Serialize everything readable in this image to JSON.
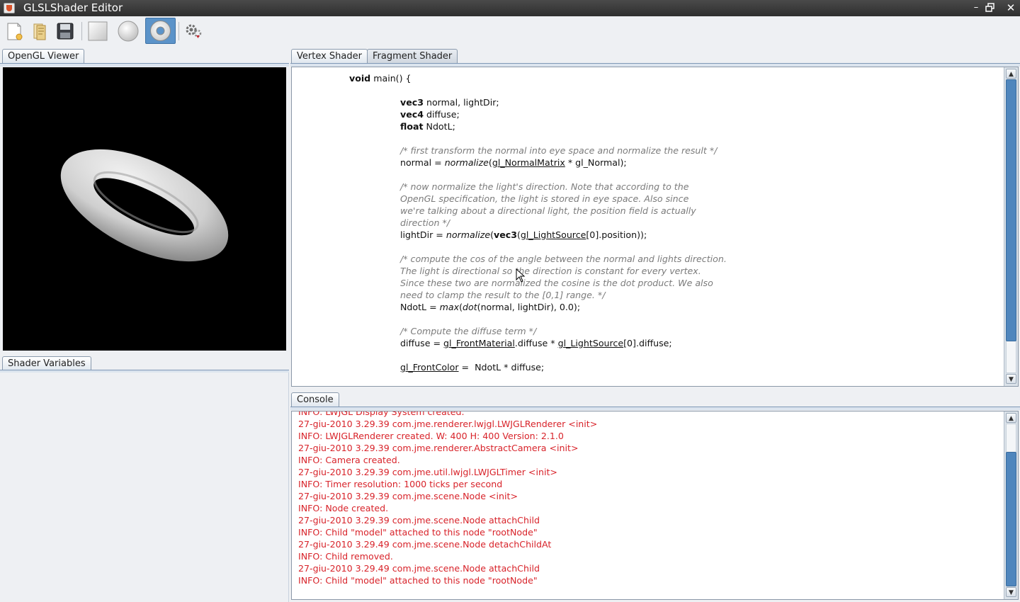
{
  "window": {
    "title": "GLSLShader Editor"
  },
  "toolbar": {
    "buttons": [
      {
        "name": "new-shader",
        "icon": "new-file-icon"
      },
      {
        "name": "open-shader",
        "icon": "open-folder-icon"
      },
      {
        "name": "save-shader",
        "icon": "floppy-disk-icon"
      },
      {
        "name": "quad-model",
        "icon": "square-icon"
      },
      {
        "name": "sphere-model",
        "icon": "sphere-icon"
      },
      {
        "name": "torus-model",
        "icon": "torus-icon",
        "selected": true
      },
      {
        "name": "compile-shader",
        "icon": "gears-icon"
      }
    ]
  },
  "left": {
    "viewer_tab": "OpenGL Viewer",
    "variables_tab": "Shader Variables"
  },
  "editor": {
    "tabs": [
      "Vertex Shader",
      "Fragment Shader"
    ],
    "active_tab": "Vertex Shader",
    "code_lines": [
      {
        "indent": 0,
        "parts": [
          {
            "t": "void",
            "s": "kw"
          },
          {
            "t": " main() {"
          }
        ]
      },
      {
        "indent": 0,
        "parts": []
      },
      {
        "indent": 1,
        "parts": [
          {
            "t": "vec3",
            "s": "kw"
          },
          {
            "t": " normal, lightDir;"
          }
        ]
      },
      {
        "indent": 1,
        "parts": [
          {
            "t": "vec4",
            "s": "kw"
          },
          {
            "t": " diffuse;"
          }
        ]
      },
      {
        "indent": 1,
        "parts": [
          {
            "t": "float",
            "s": "kw"
          },
          {
            "t": " NdotL;"
          }
        ]
      },
      {
        "indent": 1,
        "parts": []
      },
      {
        "indent": 1,
        "parts": [
          {
            "t": "/* first transform the normal into eye space and normalize the result */",
            "s": "cm"
          }
        ]
      },
      {
        "indent": 1,
        "parts": [
          {
            "t": "normal = "
          },
          {
            "t": "normalize",
            "s": "fn"
          },
          {
            "t": "("
          },
          {
            "t": "gl_NormalMatrix",
            "s": "ul"
          },
          {
            "t": " * gl_Normal);"
          }
        ]
      },
      {
        "indent": 1,
        "parts": []
      },
      {
        "indent": 1,
        "parts": [
          {
            "t": "/* now normalize the light's direction. Note that according to the",
            "s": "cm"
          }
        ]
      },
      {
        "indent": 1,
        "parts": [
          {
            "t": "OpenGL specification, the light is stored in eye space. Also since",
            "s": "cm"
          }
        ]
      },
      {
        "indent": 1,
        "parts": [
          {
            "t": "we're talking about a directional light, the position field is actually",
            "s": "cm"
          }
        ]
      },
      {
        "indent": 1,
        "parts": [
          {
            "t": "direction */",
            "s": "cm"
          }
        ]
      },
      {
        "indent": 1,
        "parts": [
          {
            "t": "lightDir = "
          },
          {
            "t": "normalize",
            "s": "fn"
          },
          {
            "t": "("
          },
          {
            "t": "vec3",
            "s": "kw"
          },
          {
            "t": "("
          },
          {
            "t": "gl_LightSource",
            "s": "ul"
          },
          {
            "t": "[0].position));"
          }
        ]
      },
      {
        "indent": 1,
        "parts": []
      },
      {
        "indent": 1,
        "parts": [
          {
            "t": "/* compute the cos of the angle between the normal and lights direction.",
            "s": "cm"
          }
        ]
      },
      {
        "indent": 1,
        "parts": [
          {
            "t": "The light is directional so the direction is constant for every vertex.",
            "s": "cm"
          }
        ]
      },
      {
        "indent": 1,
        "parts": [
          {
            "t": "Since these two are normalized the cosine is the dot product. We also",
            "s": "cm"
          }
        ]
      },
      {
        "indent": 1,
        "parts": [
          {
            "t": "need to clamp the result to the [0,1] range. */",
            "s": "cm"
          }
        ]
      },
      {
        "indent": 1,
        "parts": [
          {
            "t": "NdotL = "
          },
          {
            "t": "max",
            "s": "fn"
          },
          {
            "t": "("
          },
          {
            "t": "dot",
            "s": "fn"
          },
          {
            "t": "(normal, lightDir), 0.0);"
          }
        ]
      },
      {
        "indent": 1,
        "parts": []
      },
      {
        "indent": 1,
        "parts": [
          {
            "t": "/* Compute the diffuse term */",
            "s": "cm"
          }
        ]
      },
      {
        "indent": 1,
        "parts": [
          {
            "t": "diffuse = "
          },
          {
            "t": "gl_FrontMaterial",
            "s": "ul"
          },
          {
            "t": ".diffuse * "
          },
          {
            "t": "gl_LightSource",
            "s": "ul"
          },
          {
            "t": "[0].diffuse;"
          }
        ]
      },
      {
        "indent": 1,
        "parts": []
      },
      {
        "indent": 1,
        "parts": [
          {
            "t": "gl_FrontColor",
            "s": "ul"
          },
          {
            "t": " =  NdotL * diffuse;"
          }
        ]
      }
    ],
    "scroll_fraction": 0.85
  },
  "console": {
    "tab": "Console",
    "lines": [
      "INFO: LWJGL Display System created.",
      "27-giu-2010 3.29.39 com.jme.renderer.lwjgl.LWJGLRenderer <init>",
      "INFO: LWJGLRenderer created. W: 400 H: 400 Version: 2.1.0",
      "27-giu-2010 3.29.39 com.jme.renderer.AbstractCamera <init>",
      "INFO: Camera created.",
      "27-giu-2010 3.29.39 com.jme.util.lwjgl.LWJGLTimer <init>",
      "INFO: Timer resolution: 1000 ticks per second",
      "27-giu-2010 3.29.39 com.jme.scene.Node <init>",
      "INFO: Node created.",
      "27-giu-2010 3.29.39 com.jme.scene.Node attachChild",
      "INFO: Child \"model\" attached to this node \"rootNode\"",
      "27-giu-2010 3.29.49 com.jme.scene.Node detachChildAt",
      "INFO: Child removed.",
      "27-giu-2010 3.29.49 com.jme.scene.Node attachChild",
      "INFO: Child \"model\" attached to this node \"rootNode\""
    ],
    "color": "#d8232a",
    "scroll_fraction": 1.0
  },
  "colors": {
    "accent": "#5b93c9",
    "comment": "#7b7b7b",
    "log": "#d8232a"
  }
}
